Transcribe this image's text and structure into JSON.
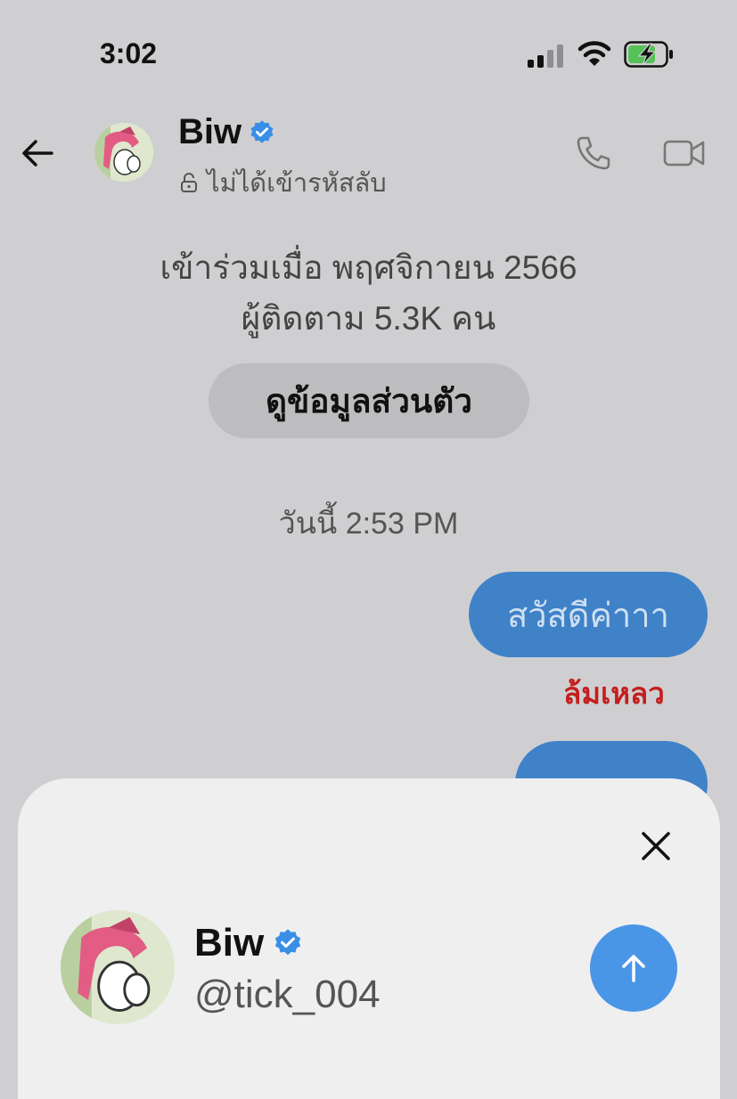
{
  "status_bar": {
    "time": "3:02"
  },
  "header": {
    "name": "Biw",
    "encryption_status": "ไม่ได้เข้ารหัสลับ"
  },
  "profile_info": {
    "joined": "เข้าร่วมเมื่อ พฤศจิกายน 2566",
    "followers": "ผู้ติดตาม 5.3K คน",
    "view_profile_label": "ดูข้อมูลส่วนตัว"
  },
  "conversation": {
    "date_separator": "วันนี้ 2:53 PM",
    "messages": [
      {
        "text": "สวัสดีค่าาา",
        "status": "ล้มเหลว"
      },
      {
        "text": ""
      }
    ]
  },
  "share_sheet": {
    "name": "Biw",
    "handle": "@tick_004"
  },
  "colors": {
    "background": "#cfcfd1",
    "bubble": "#3f82c8",
    "failed": "#c41e1e",
    "verified": "#3a8ee6",
    "send_button": "#4a96e6"
  },
  "icons": [
    "signal-icon",
    "wifi-icon",
    "battery-charging-icon",
    "back-arrow-icon",
    "verified-badge-icon",
    "lock-icon",
    "phone-icon",
    "video-icon",
    "close-icon",
    "arrow-up-icon"
  ]
}
